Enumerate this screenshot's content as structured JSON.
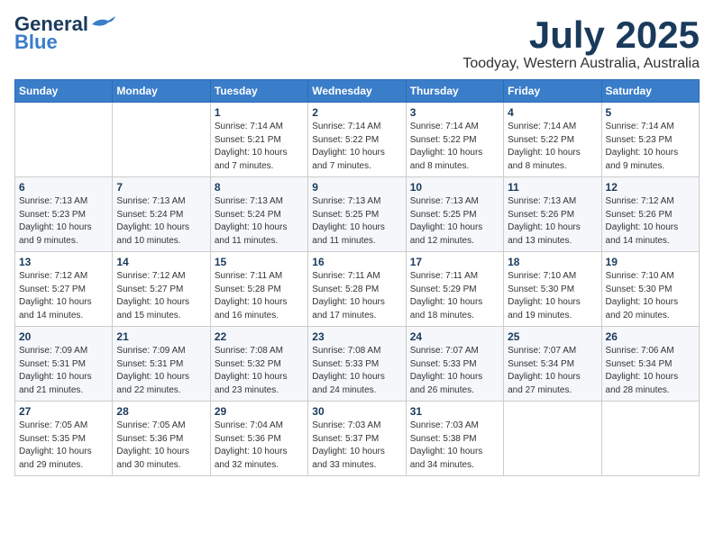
{
  "logo": {
    "line1": "General",
    "line2": "Blue"
  },
  "header": {
    "month": "July 2025",
    "location": "Toodyay, Western Australia, Australia"
  },
  "weekdays": [
    "Sunday",
    "Monday",
    "Tuesday",
    "Wednesday",
    "Thursday",
    "Friday",
    "Saturday"
  ],
  "weeks": [
    [
      {
        "day": "",
        "info": ""
      },
      {
        "day": "",
        "info": ""
      },
      {
        "day": "1",
        "info": "Sunrise: 7:14 AM\nSunset: 5:21 PM\nDaylight: 10 hours and 7 minutes."
      },
      {
        "day": "2",
        "info": "Sunrise: 7:14 AM\nSunset: 5:22 PM\nDaylight: 10 hours and 7 minutes."
      },
      {
        "day": "3",
        "info": "Sunrise: 7:14 AM\nSunset: 5:22 PM\nDaylight: 10 hours and 8 minutes."
      },
      {
        "day": "4",
        "info": "Sunrise: 7:14 AM\nSunset: 5:22 PM\nDaylight: 10 hours and 8 minutes."
      },
      {
        "day": "5",
        "info": "Sunrise: 7:14 AM\nSunset: 5:23 PM\nDaylight: 10 hours and 9 minutes."
      }
    ],
    [
      {
        "day": "6",
        "info": "Sunrise: 7:13 AM\nSunset: 5:23 PM\nDaylight: 10 hours and 9 minutes."
      },
      {
        "day": "7",
        "info": "Sunrise: 7:13 AM\nSunset: 5:24 PM\nDaylight: 10 hours and 10 minutes."
      },
      {
        "day": "8",
        "info": "Sunrise: 7:13 AM\nSunset: 5:24 PM\nDaylight: 10 hours and 11 minutes."
      },
      {
        "day": "9",
        "info": "Sunrise: 7:13 AM\nSunset: 5:25 PM\nDaylight: 10 hours and 11 minutes."
      },
      {
        "day": "10",
        "info": "Sunrise: 7:13 AM\nSunset: 5:25 PM\nDaylight: 10 hours and 12 minutes."
      },
      {
        "day": "11",
        "info": "Sunrise: 7:13 AM\nSunset: 5:26 PM\nDaylight: 10 hours and 13 minutes."
      },
      {
        "day": "12",
        "info": "Sunrise: 7:12 AM\nSunset: 5:26 PM\nDaylight: 10 hours and 14 minutes."
      }
    ],
    [
      {
        "day": "13",
        "info": "Sunrise: 7:12 AM\nSunset: 5:27 PM\nDaylight: 10 hours and 14 minutes."
      },
      {
        "day": "14",
        "info": "Sunrise: 7:12 AM\nSunset: 5:27 PM\nDaylight: 10 hours and 15 minutes."
      },
      {
        "day": "15",
        "info": "Sunrise: 7:11 AM\nSunset: 5:28 PM\nDaylight: 10 hours and 16 minutes."
      },
      {
        "day": "16",
        "info": "Sunrise: 7:11 AM\nSunset: 5:28 PM\nDaylight: 10 hours and 17 minutes."
      },
      {
        "day": "17",
        "info": "Sunrise: 7:11 AM\nSunset: 5:29 PM\nDaylight: 10 hours and 18 minutes."
      },
      {
        "day": "18",
        "info": "Sunrise: 7:10 AM\nSunset: 5:30 PM\nDaylight: 10 hours and 19 minutes."
      },
      {
        "day": "19",
        "info": "Sunrise: 7:10 AM\nSunset: 5:30 PM\nDaylight: 10 hours and 20 minutes."
      }
    ],
    [
      {
        "day": "20",
        "info": "Sunrise: 7:09 AM\nSunset: 5:31 PM\nDaylight: 10 hours and 21 minutes."
      },
      {
        "day": "21",
        "info": "Sunrise: 7:09 AM\nSunset: 5:31 PM\nDaylight: 10 hours and 22 minutes."
      },
      {
        "day": "22",
        "info": "Sunrise: 7:08 AM\nSunset: 5:32 PM\nDaylight: 10 hours and 23 minutes."
      },
      {
        "day": "23",
        "info": "Sunrise: 7:08 AM\nSunset: 5:33 PM\nDaylight: 10 hours and 24 minutes."
      },
      {
        "day": "24",
        "info": "Sunrise: 7:07 AM\nSunset: 5:33 PM\nDaylight: 10 hours and 26 minutes."
      },
      {
        "day": "25",
        "info": "Sunrise: 7:07 AM\nSunset: 5:34 PM\nDaylight: 10 hours and 27 minutes."
      },
      {
        "day": "26",
        "info": "Sunrise: 7:06 AM\nSunset: 5:34 PM\nDaylight: 10 hours and 28 minutes."
      }
    ],
    [
      {
        "day": "27",
        "info": "Sunrise: 7:05 AM\nSunset: 5:35 PM\nDaylight: 10 hours and 29 minutes."
      },
      {
        "day": "28",
        "info": "Sunrise: 7:05 AM\nSunset: 5:36 PM\nDaylight: 10 hours and 30 minutes."
      },
      {
        "day": "29",
        "info": "Sunrise: 7:04 AM\nSunset: 5:36 PM\nDaylight: 10 hours and 32 minutes."
      },
      {
        "day": "30",
        "info": "Sunrise: 7:03 AM\nSunset: 5:37 PM\nDaylight: 10 hours and 33 minutes."
      },
      {
        "day": "31",
        "info": "Sunrise: 7:03 AM\nSunset: 5:38 PM\nDaylight: 10 hours and 34 minutes."
      },
      {
        "day": "",
        "info": ""
      },
      {
        "day": "",
        "info": ""
      }
    ]
  ]
}
